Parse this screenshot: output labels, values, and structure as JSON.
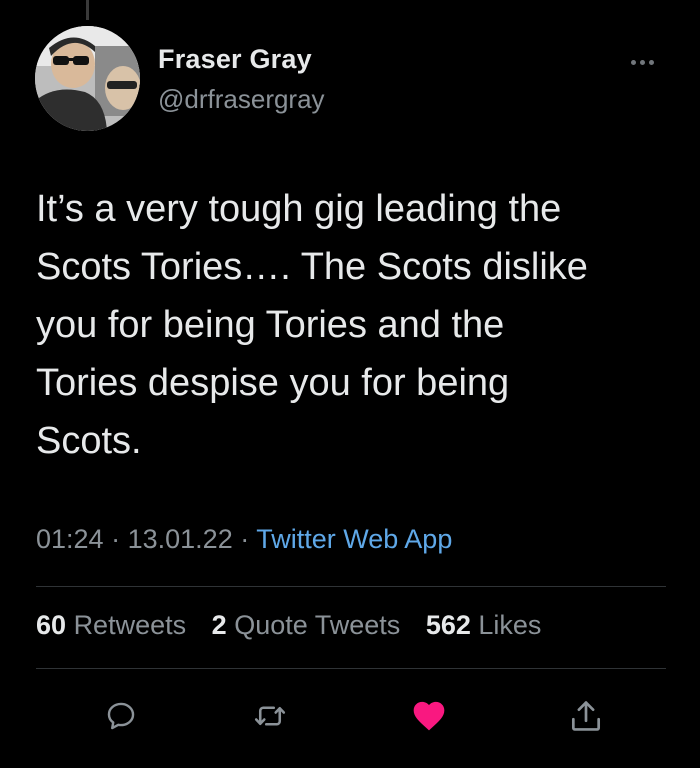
{
  "author": {
    "display_name": "Fraser Gray",
    "handle": "@drfrasergray"
  },
  "tweet": {
    "text": "It’s a very tough gig leading the\nScots Tories…. The Scots dislike\nyou for being Tories and the\nTories despise you for being\nScots.",
    "time": "01:24",
    "date": "13.01.22",
    "separator": "·",
    "source": "Twitter Web App"
  },
  "stats": {
    "retweets_count": "60",
    "retweets_label": "Retweets",
    "quote_count": "2",
    "quote_label": "Quote Tweets",
    "likes_count": "562",
    "likes_label": "Likes"
  },
  "actions": {
    "reply_icon": "reply-icon",
    "retweet_icon": "retweet-icon",
    "like_icon": "heart-icon",
    "share_icon": "share-icon",
    "liked": true
  },
  "colors": {
    "background": "#000000",
    "text": "#e7e9ea",
    "muted": "#8b9298",
    "link": "#5fa8e8",
    "like": "#f91880"
  }
}
